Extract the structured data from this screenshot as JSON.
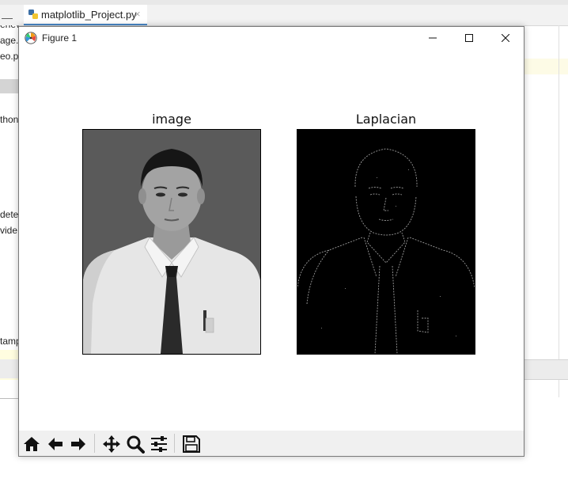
{
  "ide": {
    "tab_label": "matplotlib_Project.py",
    "tab_close": "×",
    "minus": "—",
    "left_fragments": [
      "enev",
      "age.p",
      "eo.p",
      "thon",
      "dete",
      "vide",
      "tamp"
    ]
  },
  "figure_window": {
    "title": "Figure 1"
  },
  "plots": [
    {
      "title": "image",
      "style": "grayscale photo",
      "background": "#555555"
    },
    {
      "title": "Laplacian",
      "style": "edge map",
      "background": "#000000"
    }
  ],
  "toolbar": {
    "icons": [
      "home-icon",
      "back-icon",
      "forward-icon",
      "pan-icon",
      "zoom-icon",
      "configure-subplots-icon",
      "save-icon"
    ]
  },
  "colors": {
    "accent": "#4a88c7",
    "toolbar_bg": "#f0f0f0"
  }
}
